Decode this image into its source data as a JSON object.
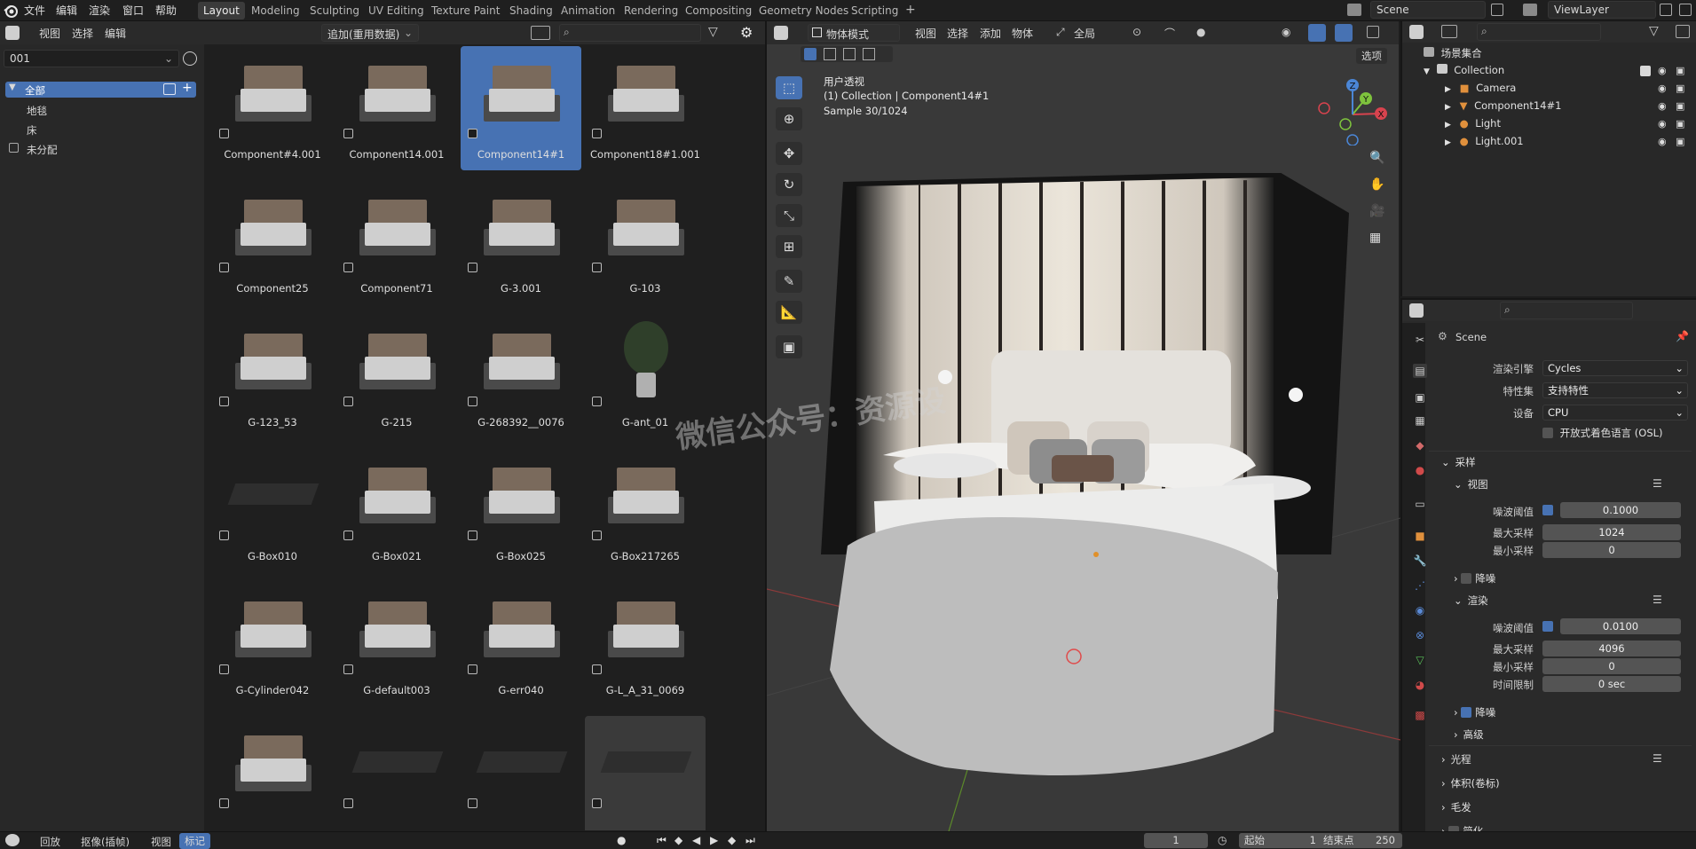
{
  "app": {
    "logo": "blender-logo-icon"
  },
  "menu": [
    "文件",
    "编辑",
    "渲染",
    "窗口",
    "帮助"
  ],
  "workspaces": [
    "Layout",
    "Modeling",
    "Sculpting",
    "UV Editing",
    "Texture Paint",
    "Shading",
    "Animation",
    "Rendering",
    "Compositing",
    "Geometry Nodes",
    "Scripting"
  ],
  "workspace_add": "+",
  "scene_field": "Scene",
  "viewlayer_field": "ViewLayer",
  "asset_browser": {
    "menu": [
      "视图",
      "选择",
      "编辑"
    ],
    "library_select": "追加(重用数据)",
    "catalog_field": "001",
    "catalog_items": [
      "全部",
      "地毯",
      "床",
      "未分配"
    ],
    "search_placeholder": "",
    "assets": [
      {
        "name": "Component#4.001",
        "kind": "bed"
      },
      {
        "name": "Component14.001",
        "kind": "bed"
      },
      {
        "name": "Component14#1",
        "kind": "bed",
        "selected": true
      },
      {
        "name": "Component18#1.001",
        "kind": "bed"
      },
      {
        "name": "Component25",
        "kind": "bed"
      },
      {
        "name": "Component71",
        "kind": "bed"
      },
      {
        "name": "G-3.001",
        "kind": "bed"
      },
      {
        "name": "G-103",
        "kind": "bed"
      },
      {
        "name": "G-123_53",
        "kind": "bed"
      },
      {
        "name": "G-215",
        "kind": "bed"
      },
      {
        "name": "G-268392__0076",
        "kind": "bed"
      },
      {
        "name": "G-ant_01",
        "kind": "plant"
      },
      {
        "name": "G-Box010",
        "kind": "rug"
      },
      {
        "name": "G-Box021",
        "kind": "bed"
      },
      {
        "name": "G-Box025",
        "kind": "bed"
      },
      {
        "name": "G-Box217265",
        "kind": "bed"
      },
      {
        "name": "G-Cylinder042",
        "kind": "bed"
      },
      {
        "name": "G-default003",
        "kind": "bed"
      },
      {
        "name": "G-err040",
        "kind": "bed"
      },
      {
        "name": "G-L_A_31_0069",
        "kind": "bed"
      },
      {
        "name": "",
        "kind": "bed"
      },
      {
        "name": "",
        "kind": "rug"
      },
      {
        "name": "",
        "kind": "rug"
      },
      {
        "name": "",
        "kind": "rug",
        "hover": true
      }
    ]
  },
  "viewport": {
    "mode": "物体模式",
    "menu": [
      "视图",
      "选择",
      "添加",
      "物体"
    ],
    "transform": "全局",
    "options": "选项",
    "info_line1": "用户透视",
    "info_line2": "(1) Collection | Component14#1",
    "info_line3": "Sample 30/1024",
    "watermark": "微信公众号：资源设",
    "axes": {
      "x": "X",
      "y": "Y",
      "z": "Z"
    }
  },
  "outliner": {
    "root": "场景集合",
    "collection": "Collection",
    "items": [
      "Camera",
      "Component14#1",
      "Light",
      "Light.001"
    ]
  },
  "properties": {
    "scene": "Scene",
    "render_engine_label": "渲染引擎",
    "render_engine": "Cycles",
    "feature_set_label": "特性集",
    "feature_set": "支持特性",
    "device_label": "设备",
    "device": "CPU",
    "osl_label": "开放式着色语言 (OSL)",
    "sampling": "采样",
    "viewport_section": "视图",
    "noise_threshold_label": "噪波阈值",
    "viewport_noise_threshold": "0.1000",
    "max_samples_label": "最大采样",
    "viewport_max_samples": "1024",
    "min_samples_label": "最小采样",
    "viewport_min_samples": "0",
    "denoise_label": "降噪",
    "render_section": "渲染",
    "render_noise_threshold": "0.0100",
    "render_max_samples": "4096",
    "render_min_samples": "0",
    "time_limit_label": "时间限制",
    "time_limit": "0 sec",
    "advanced": "高级",
    "light_paths": "光程",
    "volumes": "体积(卷标)",
    "hair": "毛发",
    "simplify": "简化"
  },
  "timeline": {
    "menu": [
      "回放",
      "抠像(插帧)",
      "视图",
      "标记"
    ],
    "current_frame": "1",
    "start_label": "起始",
    "start": "1",
    "end_label": "结束点",
    "end": "250"
  }
}
